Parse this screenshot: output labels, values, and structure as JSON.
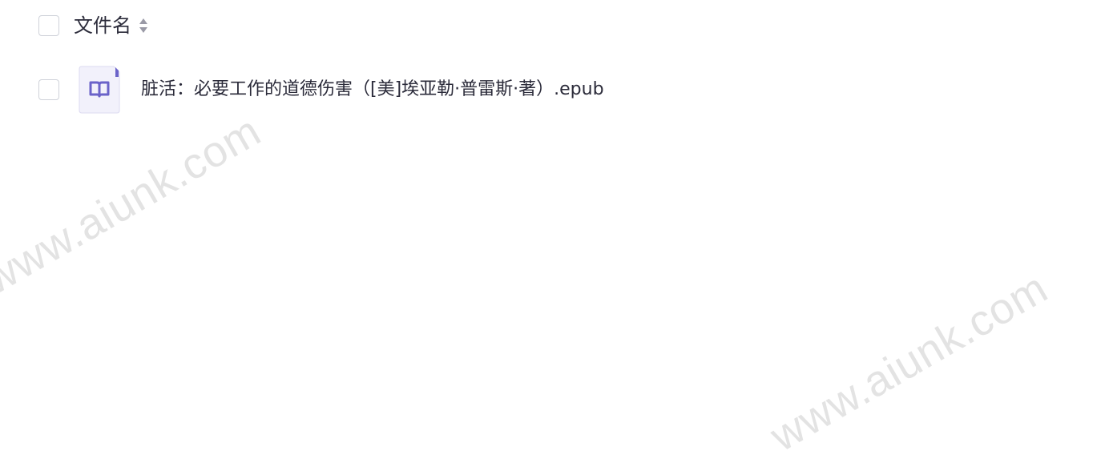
{
  "header": {
    "column_label": "文件名",
    "sort_icon": "sort-updown-icon"
  },
  "files": [
    {
      "name": "脏活：必要工作的道德伤害（[美]埃亚勒·普雷斯·著）.epub",
      "icon": "epub-book-icon"
    }
  ],
  "watermark": {
    "text": "www.aiunk.com"
  },
  "colors": {
    "checkbox_border": "#cfd2d9",
    "text": "#2b2b3a",
    "icon_accent": "#6b63c9",
    "icon_bg": "#f2f1fb",
    "sort_icon": "#9a9aa6",
    "watermark": "#e3e3e3"
  }
}
